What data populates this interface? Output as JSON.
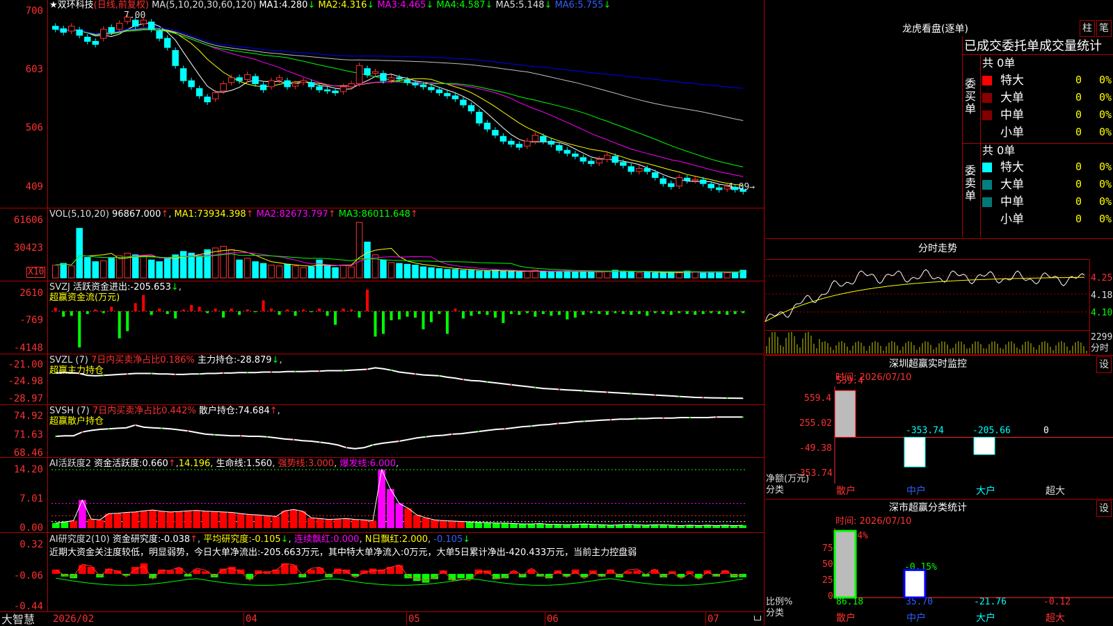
{
  "colors": {
    "up": "#ff3232",
    "down": "#00ffff",
    "ma1": "#ffffff",
    "ma2": "#ffff00",
    "ma3": "#ff00ff",
    "ma4": "#00ff00",
    "ma5": "#c0c0c0",
    "ma6": "#0000ff",
    "frame": "#b00000"
  },
  "price": {
    "star": "★",
    "name": "双环科技",
    "period": "(日线,前复权)",
    "ma_label": "MA(5,10,20,30,60,120)",
    "ma": [
      {
        "label": "MA1:",
        "value": "4.280",
        "arrow": "↓"
      },
      {
        "label": "MA2:",
        "value": "4.316",
        "arrow": "↓"
      },
      {
        "label": "MA3:",
        "value": "4.465",
        "arrow": "↓"
      },
      {
        "label": "MA4:",
        "value": "4.587",
        "arrow": "↓"
      },
      {
        "label": "MA5:",
        "value": "5.148",
        "arrow": "↓"
      },
      {
        "label": "MA6:",
        "value": "5.755",
        "arrow": "↓"
      }
    ],
    "yticks": [
      "700",
      "603",
      "506",
      "409"
    ],
    "high_label": "7.00",
    "low_label": "4.09→"
  },
  "vol": {
    "title": "VOL(5,10,20)",
    "value": "96867.000",
    "arrow": "↑",
    "ma": [
      {
        "label": "MA1:",
        "value": "73934.398",
        "arrow": "↑"
      },
      {
        "label": "MA2:",
        "value": "82673.797",
        "arrow": "↑"
      },
      {
        "label": "MA3:",
        "value": "86011.648",
        "arrow": "↑"
      }
    ],
    "yticks": [
      "61606",
      "30423"
    ],
    "unit": "X10"
  },
  "svzj": {
    "title": "SVZJ",
    "line1_label": "活跃资金进出:",
    "line1_value": "-205.653",
    "arrow": "↓",
    "line2": "超赢资金流(万元)",
    "yticks": [
      "2610",
      "-769",
      "-4148"
    ]
  },
  "svzl": {
    "title": "SVZL (7)",
    "desc": "7日内买卖净占比0.186%",
    "hold_label": "主力持仓:",
    "hold_value": "-28.879",
    "arrow": "↓",
    "comma": ",",
    "line2": "超赢主力持仓",
    "yticks": [
      "-21.00",
      "-24.98",
      "-28.97"
    ]
  },
  "svsh": {
    "title": "SVSH (7)",
    "desc": "7日内买卖净占比0.442%",
    "hold_label": "散户持仓:",
    "hold_value": "74.684",
    "arrow": "↑",
    "comma": ",",
    "line2": "超赢散户持仓",
    "yticks": [
      "74.92",
      "71.63",
      "68.46"
    ]
  },
  "ai1": {
    "title": "AI活跃度2",
    "a_label": "资金活跃度:",
    "a_value": "0.660",
    "a_arrow": "↑",
    "b_value": "14.196",
    "c_label": "生命线:",
    "c_value": "1.560",
    "d_label": "强势线:",
    "d_value": "3.000",
    "e_label": "爆发线:",
    "e_value": "6.000",
    "yticks": [
      "14.20",
      "7.01",
      "0.00"
    ]
  },
  "ai2": {
    "title": "AI研究度2(10)",
    "a_label": "资金研究度:",
    "a_value": "-0.038",
    "a_arrow": "↑",
    "b_label": "平均研究度:",
    "b_value": "-0.105",
    "b_arrow": "↓",
    "c_label": "连续飘红:",
    "c_value": "0.000",
    "d_label": "N日飘红:",
    "d_value": "2.000",
    "e_value": "-0.105",
    "e_arrow": "↓",
    "comment": "近期大资金关注度较低，明显弱势，今日大单净流出:-205.663万元，其中特大单净流入:0万元，大单5日累计净出-420.433万元，当前主力控盘弱",
    "yticks": [
      "0.32",
      "-0.06",
      "-0.44"
    ]
  },
  "xaxis": {
    "labels": [
      "2026/02",
      "04",
      "05",
      "06",
      "07"
    ],
    "brand": "大智慧"
  },
  "right": {
    "longhu_title": "龙虎看盘(逐单)",
    "btn_zhu": "柱",
    "btn_bi": "笔",
    "order_title": "已成交委托单成交量统计",
    "buy": {
      "side": "委买单",
      "total": "共 0单",
      "rows": [
        {
          "name": "特大",
          "count": "0",
          "pct": "0%",
          "color": "#ff0000"
        },
        {
          "name": "大单",
          "count": "0",
          "pct": "0%",
          "color": "#8b0000"
        },
        {
          "name": "中单",
          "count": "0",
          "pct": "0%",
          "color": "#800000"
        },
        {
          "name": "小单",
          "count": "0",
          "pct": "0%",
          "color": ""
        }
      ]
    },
    "sell": {
      "side": "委卖单",
      "total": "共 0单",
      "rows": [
        {
          "name": "特大",
          "count": "0",
          "pct": "0%",
          "color": "#00ffff"
        },
        {
          "name": "大单",
          "count": "0",
          "pct": "0%",
          "color": "#008080"
        },
        {
          "name": "中单",
          "count": "0",
          "pct": "0%",
          "color": "#007878"
        },
        {
          "name": "小单",
          "count": "0",
          "pct": "0%",
          "color": ""
        }
      ]
    },
    "intraday": {
      "title": "分时走势",
      "yticks": [
        "4.255",
        "4.180",
        "4.105"
      ],
      "vol_tick": "2299",
      "vol_label": "分时"
    },
    "sz_monitor": {
      "title": "深圳超赢实时监控",
      "btn": "设",
      "time": "时间: 2026/07/10",
      "yticks": [
        "559.4",
        "255.02",
        "-49.38",
        "-353.74"
      ],
      "ylabel": "净额(万元)",
      "xlabel": "分类",
      "cats": [
        "散户",
        "中户",
        "大户",
        "超大"
      ]
    },
    "sz_stats": {
      "title": "深市超赢分类统计",
      "btn": "设",
      "time": "时间: 2026/07/10",
      "yticks": [
        "75",
        "50",
        "25",
        "0"
      ],
      "ylabel": "比例%",
      "xlabel": "分类",
      "cats": [
        "散户",
        "中户",
        "大户",
        "超大"
      ],
      "top_labels": [
        "+0.24%",
        "-0.15%"
      ],
      "bottom_labels": [
        "86.18",
        "35.70",
        "-21.76",
        "-0.12"
      ]
    }
  },
  "chart_data": [
    {
      "type": "candlestick",
      "title": "双环科技 (日线,前复权)",
      "ylim": [
        4.0,
        7.1
      ],
      "yticks": [
        7.0,
        6.03,
        5.06,
        4.09
      ],
      "close": [
        6.8,
        6.75,
        6.85,
        6.7,
        6.6,
        6.55,
        6.8,
        6.75,
        6.9,
        7.0,
        6.85,
        6.95,
        6.8,
        6.65,
        6.5,
        6.2,
        5.95,
        5.85,
        5.7,
        5.6,
        5.75,
        5.9,
        6.0,
        5.95,
        6.05,
        5.9,
        5.8,
        5.95,
        6.0,
        5.85,
        5.9,
        5.95,
        5.85,
        5.8,
        5.78,
        5.75,
        5.85,
        5.9,
        6.2,
        6.05,
        6.1,
        5.95,
        6.0,
        5.98,
        5.92,
        5.88,
        5.85,
        5.8,
        5.75,
        5.7,
        5.65,
        5.55,
        5.45,
        5.25,
        5.15,
        5.05,
        4.95,
        4.9,
        4.85,
        4.95,
        5.05,
        4.95,
        4.9,
        4.8,
        4.75,
        4.7,
        4.62,
        4.58,
        4.65,
        4.72,
        4.6,
        4.55,
        4.45,
        4.5,
        4.45,
        4.35,
        4.25,
        4.2,
        4.35,
        4.3,
        4.32,
        4.25,
        4.18,
        4.15,
        4.2,
        4.15,
        4.12
      ],
      "open_offset": [
        0.05,
        0.06,
        -0.08,
        0.09,
        0.07,
        0.05,
        -0.15,
        0.08,
        -0.1,
        -0.07,
        0.1,
        -0.06,
        0.12,
        0.12,
        0.15,
        0.25,
        0.2,
        0.1,
        0.12,
        0.08,
        -0.1,
        -0.12,
        -0.08,
        0.05,
        -0.08,
        0.12,
        0.08,
        -0.1,
        -0.04,
        0.1,
        -0.04,
        -0.03,
        0.07,
        0.05,
        0.02,
        0.03,
        -0.08,
        -0.05,
        -0.3,
        0.1,
        -0.03,
        0.12,
        -0.04,
        0.02,
        0.04,
        0.03,
        0.03,
        0.04,
        0.05,
        0.04,
        0.05,
        0.08,
        0.09,
        0.18,
        0.1,
        0.08,
        0.08,
        0.05,
        0.05,
        -0.08,
        -0.1,
        0.08,
        0.05,
        0.08,
        0.05,
        0.04,
        0.06,
        0.04,
        -0.06,
        -0.07,
        0.1,
        0.05,
        0.08,
        -0.05,
        0.05,
        0.08,
        0.08,
        0.05,
        -0.14,
        0.04,
        -0.02,
        0.06,
        0.06,
        0.03,
        -0.04,
        0.04,
        0.03
      ]
    },
    {
      "type": "bar",
      "title": "VOL(5,10,20)",
      "ylim": [
        0,
        65000
      ],
      "values": [
        15000,
        17000,
        14000,
        58000,
        24000,
        19000,
        20000,
        23000,
        26000,
        29000,
        27000,
        25000,
        21000,
        19000,
        23000,
        27000,
        31000,
        29000,
        26000,
        33000,
        35000,
        37000,
        33000,
        21000,
        23000,
        19000,
        17000,
        15000,
        14000,
        16000,
        14000,
        12000,
        13000,
        21000,
        14000,
        12000,
        15000,
        13000,
        65000,
        42000,
        27000,
        21000,
        18000,
        17000,
        16000,
        15000,
        13000,
        12000,
        11000,
        10000,
        10000,
        9000,
        9000,
        8000,
        8000,
        9000,
        8000,
        8000,
        7000,
        8000,
        9000,
        8000,
        7000,
        7000,
        8000,
        7000,
        8000,
        7000,
        7000,
        8000,
        9000,
        8000,
        7000,
        6000,
        7000,
        6000,
        6000,
        7000,
        6000,
        8000,
        7000,
        6000,
        7000,
        7000,
        6000,
        7000,
        9000
      ]
    },
    {
      "type": "bar",
      "title": "超赢资金流(万元)",
      "ylim": [
        -4148,
        2610
      ],
      "values": [
        400,
        -600,
        -500,
        -4000,
        -300,
        200,
        -200,
        500,
        -3000,
        -2200,
        900,
        1800,
        -400,
        300,
        -300,
        -800,
        200,
        700,
        500,
        -200,
        300,
        -700,
        300,
        -400,
        200,
        -100,
        1200,
        300,
        -400,
        200,
        -500,
        200,
        -100,
        300,
        -500,
        -1500,
        300,
        200,
        -700,
        2400,
        -2800,
        -2500,
        -1000,
        -900,
        -600,
        -700,
        -2000,
        -1200,
        -300,
        -2500,
        300,
        -800,
        -500,
        -300,
        -400,
        -700,
        -1300,
        -300,
        -400,
        -200,
        -600,
        -300,
        -500,
        -400,
        -900,
        -700,
        -400,
        -200,
        -300,
        -400,
        -200,
        -300,
        -400,
        -300,
        -500,
        -200,
        -300,
        -400,
        -200,
        -300,
        -400,
        -300,
        -200,
        -300,
        -400,
        -300,
        -200
      ]
    },
    {
      "type": "line",
      "title": "超赢主力持仓",
      "ylim": [
        -29.3,
        -21.0
      ],
      "points": [
        -23.5,
        -23.4,
        -23.4,
        -23.6,
        -24.0,
        -24.1,
        -24.0,
        -23.9,
        -23.8,
        -23.7,
        -23.6,
        -23.6,
        -23.6,
        -23.7,
        -23.7,
        -23.8,
        -23.8,
        -23.7,
        -23.7,
        -23.6,
        -23.6,
        -23.5,
        -23.5,
        -23.4,
        -23.4,
        -23.4,
        -23.3,
        -23.3,
        -23.3,
        -23.2,
        -23.2,
        -23.2,
        -23.1,
        -23.1,
        -23.0,
        -23.0,
        -23.0,
        -22.9,
        -22.8,
        -22.7,
        -22.4,
        -22.6,
        -22.9,
        -23.3,
        -23.5,
        -23.7,
        -23.9,
        -24.0,
        -24.1,
        -24.4,
        -24.6,
        -24.9,
        -25.1,
        -25.2,
        -25.4,
        -25.6,
        -25.8,
        -26.0,
        -26.2,
        -26.4,
        -26.6,
        -26.8,
        -26.9,
        -27.0,
        -27.1,
        -27.2,
        -27.3,
        -27.4,
        -27.5,
        -27.6,
        -27.7,
        -27.8,
        -27.9,
        -28.0,
        -28.1,
        -28.2,
        -28.3,
        -28.4,
        -28.5,
        -28.6,
        -28.7,
        -28.75,
        -28.8,
        -28.82,
        -28.85,
        -28.87,
        -28.88
      ]
    },
    {
      "type": "line",
      "title": "超赢散户持仓",
      "ylim": [
        68.0,
        75.5
      ],
      "points": [
        71.1,
        71.2,
        71.2,
        71.9,
        72.2,
        72.4,
        72.5,
        72.6,
        72.7,
        73.2,
        72.8,
        72.7,
        72.6,
        72.5,
        72.3,
        72.1,
        71.8,
        71.5,
        71.4,
        71.3,
        71.2,
        71.2,
        71.1,
        71.1,
        71.0,
        70.8,
        70.6,
        70.5,
        70.3,
        70.2,
        70.0,
        69.8,
        69.5,
        69.0,
        68.8,
        69.0,
        69.5,
        69.8,
        70.0,
        70.2,
        70.5,
        70.8,
        71.0,
        71.2,
        71.3,
        71.5,
        71.6,
        71.8,
        72.0,
        72.2,
        72.4,
        72.5,
        72.7,
        72.9,
        73.0,
        73.2,
        73.3,
        73.5,
        73.6,
        73.8,
        73.9,
        74.0,
        74.1,
        74.2,
        74.3,
        74.3,
        74.4,
        74.4,
        74.5,
        74.5,
        74.5,
        74.6,
        74.6,
        74.6,
        74.6,
        74.7,
        74.7,
        74.7,
        74.68
      ]
    },
    {
      "type": "bar",
      "title": "AI活跃度2",
      "ylim": [
        0,
        14.2
      ],
      "values": [
        1.2,
        1.5,
        1.8,
        6.8,
        2.2,
        2.0,
        3.5,
        3.6,
        3.8,
        3.9,
        4.2,
        4.4,
        4.1,
        3.9,
        4.0,
        4.2,
        4.3,
        4.1,
        4.0,
        3.9,
        3.8,
        3.5,
        3.3,
        3.2,
        3.0,
        2.8,
        4.2,
        4.5,
        4.1,
        2.5,
        2.3,
        2.1,
        2.2,
        2.3,
        2.1,
        2.0,
        1.8,
        14.2,
        9.5,
        6.0,
        4.8,
        3.2,
        2.5,
        2.0,
        1.8,
        1.7,
        1.6,
        1.5,
        1.4,
        1.3,
        1.2,
        1.2,
        1.1,
        1.0,
        1.0,
        1.1,
        0.9,
        0.9,
        0.8,
        0.9,
        1.0,
        0.9,
        0.8,
        0.7,
        0.8,
        0.9,
        0.8,
        0.7,
        0.8,
        0.8,
        0.7,
        0.6,
        0.7,
        0.6,
        0.7,
        0.6,
        0.7,
        0.6,
        0.66
      ]
    },
    {
      "type": "bar",
      "title": "AI研究度2(10)",
      "ylim": [
        -0.44,
        0.32
      ],
      "values": [
        0.05,
        -0.03,
        -0.05,
        0.1,
        0.08,
        -0.04,
        0.06,
        0.04,
        -0.02,
        0.08,
        0.12,
        -0.05,
        0.05,
        0.04,
        0.07,
        -0.03,
        0.05,
        0.03,
        -0.04,
        0.06,
        0.08,
        0.05,
        -0.06,
        0.04,
        0.03,
        0.05,
        0.12,
        0.1,
        -0.04,
        0.05,
        0.07,
        -0.04,
        0.06,
        0.05,
        -0.03,
        0.04,
        0.06,
        0.05,
        0.08,
        0.1,
        -0.05,
        -0.08,
        -0.1,
        -0.06,
        0.04,
        -0.07,
        -0.05,
        -0.06,
        0.05,
        0.04,
        -0.06,
        -0.05,
        0.03,
        -0.04,
        0.05,
        -0.03,
        -0.05,
        0.04,
        -0.03,
        0.05,
        -0.04,
        0.04,
        -0.03,
        0.05,
        -0.04,
        0.03,
        0.04,
        -0.03,
        0.05,
        -0.04,
        0.03,
        -0.04,
        0.03,
        -0.05,
        0.04,
        -0.03,
        0.04,
        -0.04,
        -0.038
      ]
    }
  ]
}
